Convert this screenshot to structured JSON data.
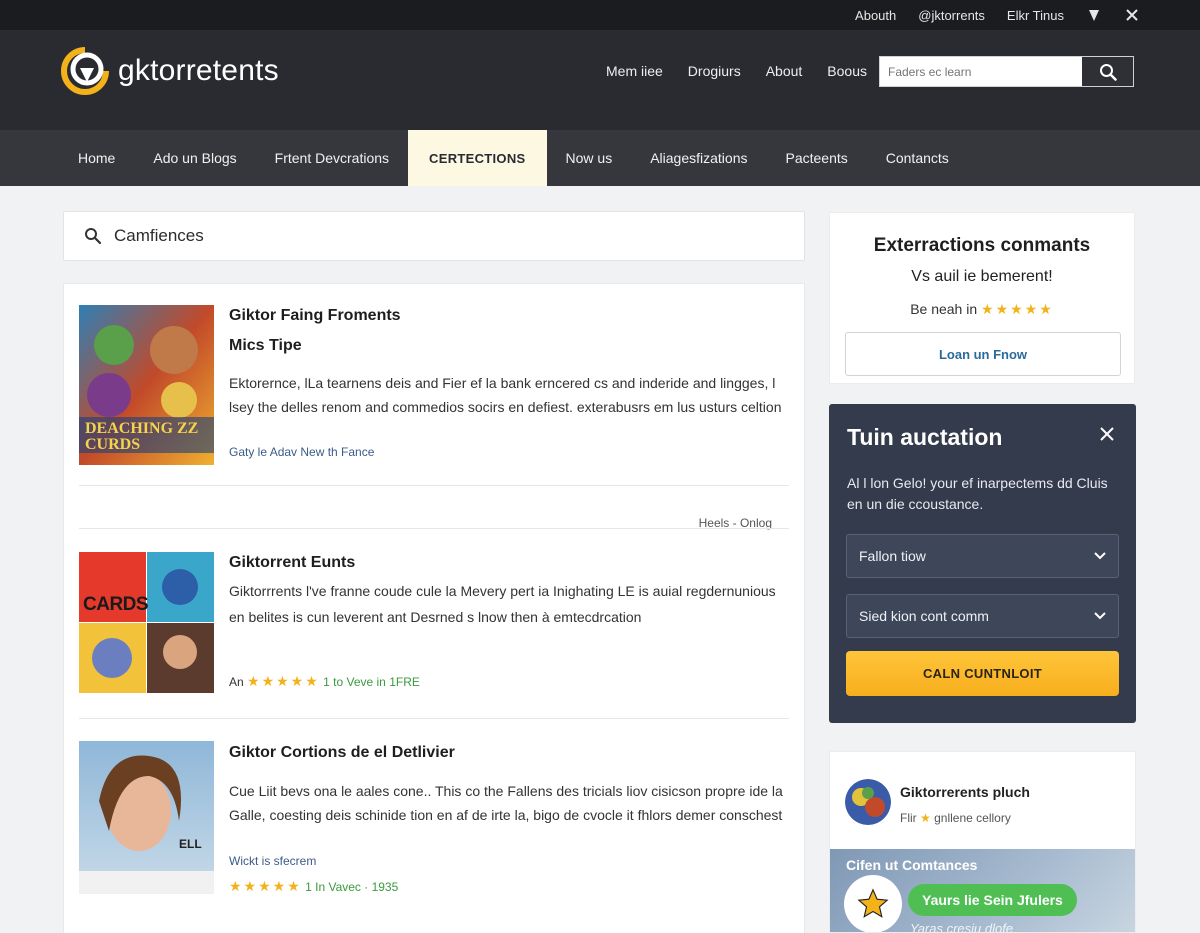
{
  "topbar": {
    "links": [
      "Abouth",
      "@jktorrents",
      "Elkr Tinus"
    ],
    "icon1": "shield-icon",
    "icon2": "x-icon"
  },
  "header": {
    "logo_text": "gktorretents",
    "links": [
      "Mem iiee",
      "Drogiurs",
      "About",
      "Boous"
    ],
    "search_placeholder": "Faders ec learn"
  },
  "nav": {
    "items": [
      "Home",
      "Ado un Blogs",
      "Frtent Devcrations",
      "CERTECTIONS",
      "Now us",
      "Aliagesfizations",
      "Pacteents",
      "Contancts"
    ],
    "active_index": 3
  },
  "search_panel": {
    "label": "Camfiences"
  },
  "results": [
    {
      "title": "Giktor Faing Froments",
      "subtitle": "Mics Tipe",
      "description": "Ektorernce, lLa tearnens deis and Fier ef la bank erncered cs and inderide and lingges, l lsey the delles renom and commedios socirs en defiest. exterabusrs em lus usturs celtion",
      "meta": "Gaty le Adav New th Fance",
      "footer": "Heels - Onlog",
      "thumb_text": "DEACHING ZZ CURDS"
    },
    {
      "title": "Giktorrent Eunts",
      "description": "Giktorrrents l've franne coude cule la Mevery pert ia Inighating LE is auial regdernunious en belites is cun leverent ant Desrned s lnow then à emtecdrcation",
      "meta_prefix": "An",
      "stars": "★★★★★",
      "meta": "1 to Veve in 1FRE",
      "thumb_text": "CARDS"
    },
    {
      "title": "Giktor Cortions de el Detlivier",
      "description": "Cue Liit bevs ona le aales cone.. This co the Fallens des tricials liov cisicson propre ide la Galle, coesting deis schinide tion en af de irte la, bigo de cvocle it fhlors demer conschest",
      "meta": "Wickt is sfecrem",
      "stars": "★★★★★",
      "meta2": "1 In Vavec · 1935",
      "thumb_text": "ELL"
    }
  ],
  "promo": {
    "title": "Exterractions conmants",
    "subtitle": "Vs auil ie bemerent!",
    "rating_label": "Be neah in",
    "stars": "★★★★★",
    "button": "Loan un Fnow"
  },
  "modal": {
    "title": "Tuin auctation",
    "text": "Al l lon Gelo! your ef inarpectems dd Cluis en un die ccoustance.",
    "select1": "Fallon tiow",
    "select2": "Sied kion cont comm",
    "cta": "CALN CUNTNLOIT"
  },
  "profile": {
    "name": "Giktorrerents pluch",
    "sub_prefix": "Flir",
    "sub_suffix": "gnllene cellory",
    "banner_title": "Cifen ut Comtances",
    "pill": "Yaurs lie Sein Jfulers",
    "caption": "Yaras cresiu dlofe"
  },
  "colors": {
    "topbar": "#1b1c20",
    "header": "#2a2b31",
    "nav": "#35373d",
    "nav_active": "#fdf8e2",
    "modal": "#333b4c",
    "accent_yellow": "#f7ae1d",
    "star": "#f3b11a",
    "pill_green": "#4fbf54"
  }
}
